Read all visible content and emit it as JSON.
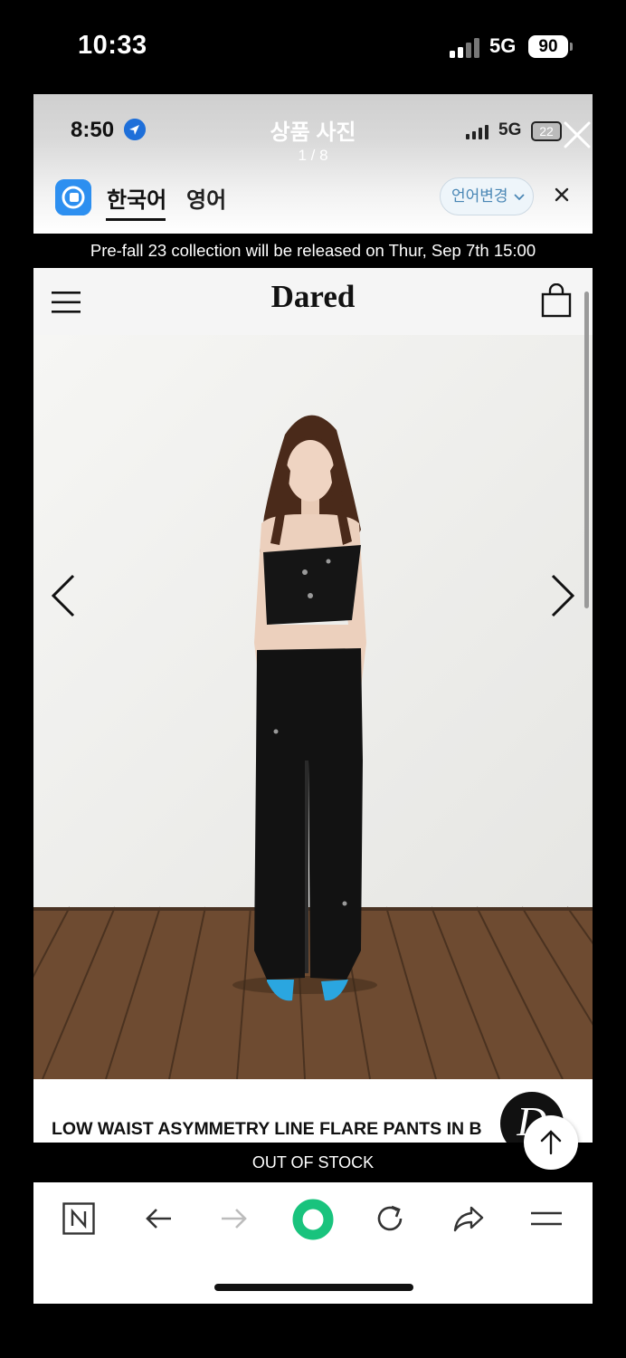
{
  "outer_status": {
    "time": "10:33",
    "network": "5G",
    "battery": "90"
  },
  "inner_status": {
    "time": "8:50",
    "network": "5G",
    "battery": "22"
  },
  "viewer": {
    "title": "상품 사진",
    "counter": "1 / 8"
  },
  "translator": {
    "lang_primary": "한국어",
    "lang_secondary": "영어",
    "change_language": "언어변경"
  },
  "banner": {
    "text": "Pre-fall 23 collection will be released on Thur, Sep 7th 15:00"
  },
  "site": {
    "logo": "Dared"
  },
  "product": {
    "name": "LOW WAIST ASYMMETRY LINE FLARE PANTS IN B",
    "badge_letter": "D",
    "stock_status": "OUT OF STOCK"
  },
  "colors": {
    "banner_bg": "#000000",
    "accent_green": "#19c37d",
    "translator_blue": "#2d8ff0"
  },
  "icons": [
    "signal-icon",
    "location-arrow-icon",
    "close-icon",
    "translate-logo-icon",
    "chevron-down-icon",
    "hamburger-menu-icon",
    "shopping-bag-icon",
    "arrow-left-icon",
    "arrow-right-icon",
    "arrow-up-icon",
    "naver-n-icon",
    "back-icon",
    "forward-icon",
    "home-circle-icon",
    "refresh-icon",
    "share-icon",
    "more-menu-icon"
  ]
}
